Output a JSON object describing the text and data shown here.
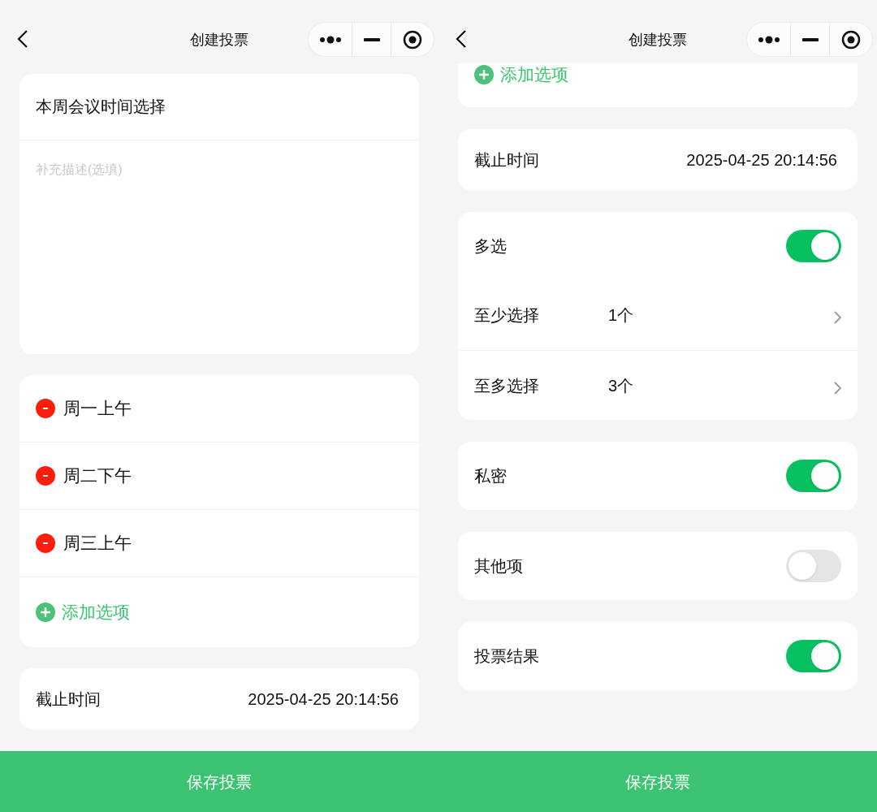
{
  "screens": [
    {
      "nav": {
        "title": "创建投票"
      },
      "title_field": {
        "value": "本周会议时间选择"
      },
      "description_field": {
        "placeholder": "补充描述(选填)"
      },
      "options": [
        {
          "label": "周一上午"
        },
        {
          "label": "周二下午"
        },
        {
          "label": "周三上午"
        }
      ],
      "add_option": "添加选项",
      "deadline": {
        "label": "截止时间",
        "value": "2025-04-25 20:14:56"
      },
      "save_button": "保存投票"
    },
    {
      "nav": {
        "title": "创建投票"
      },
      "add_option": "添加选项",
      "deadline": {
        "label": "截止时间",
        "value": "2025-04-25 20:14:56"
      },
      "settings_groups": [
        {
          "rows": [
            {
              "kind": "toggle",
              "label": "多选",
              "on": true
            },
            {
              "kind": "link",
              "label": "至少选择",
              "value": "1个"
            },
            {
              "kind": "link",
              "label": "至多选择",
              "value": "3个"
            }
          ]
        },
        {
          "rows": [
            {
              "kind": "toggle",
              "label": "私密",
              "on": true
            }
          ]
        },
        {
          "rows": [
            {
              "kind": "toggle",
              "label": "其他项",
              "on": false
            }
          ]
        },
        {
          "rows": [
            {
              "kind": "toggle",
              "label": "投票结果",
              "on": true
            }
          ]
        }
      ],
      "save_button": "保存投票"
    }
  ]
}
